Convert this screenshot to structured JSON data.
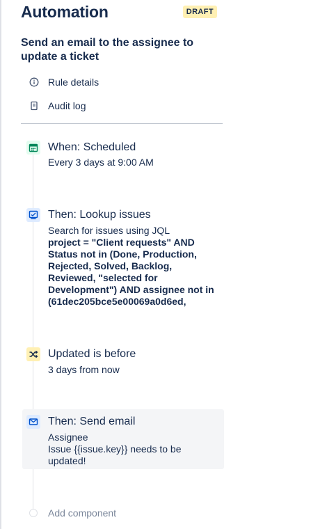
{
  "header": {
    "title": "Automation",
    "badge": "DRAFT"
  },
  "rule": {
    "name": "Send an email to the assignee to update a ticket"
  },
  "menu": {
    "rule_details": "Rule details",
    "audit_log": "Audit log"
  },
  "steps": [
    {
      "icon": "calendar-icon",
      "title": "When: Scheduled",
      "desc": "Every 3 days at 9:00 AM",
      "icon_bg": "#e3fcef",
      "icon_color": "#00875a"
    },
    {
      "icon": "lookup-issues-icon",
      "title": "Then: Lookup issues",
      "desc": "Search for issues using JQL",
      "jql": "project = \"Client requests\" AND Status not in (Done, Production, Rejected, Solved, Backlog, Reviewed, \"selected for Development\") AND assignee not in (61dec205bce5e00069a0d6ed,",
      "icon_bg": "#deebff",
      "icon_color": "#0052cc"
    },
    {
      "icon": "condition-icon",
      "title": "Updated is before",
      "desc": "3 days from now",
      "icon_bg": "#fff0b3",
      "icon_color": "#172b4d"
    },
    {
      "icon": "email-icon",
      "title": "Then: Send email",
      "desc": "Assignee",
      "desc2": "Issue {{issue.key}} needs to be updated!",
      "icon_bg": "#deebff",
      "icon_color": "#0052cc"
    }
  ],
  "add_component": "Add component"
}
